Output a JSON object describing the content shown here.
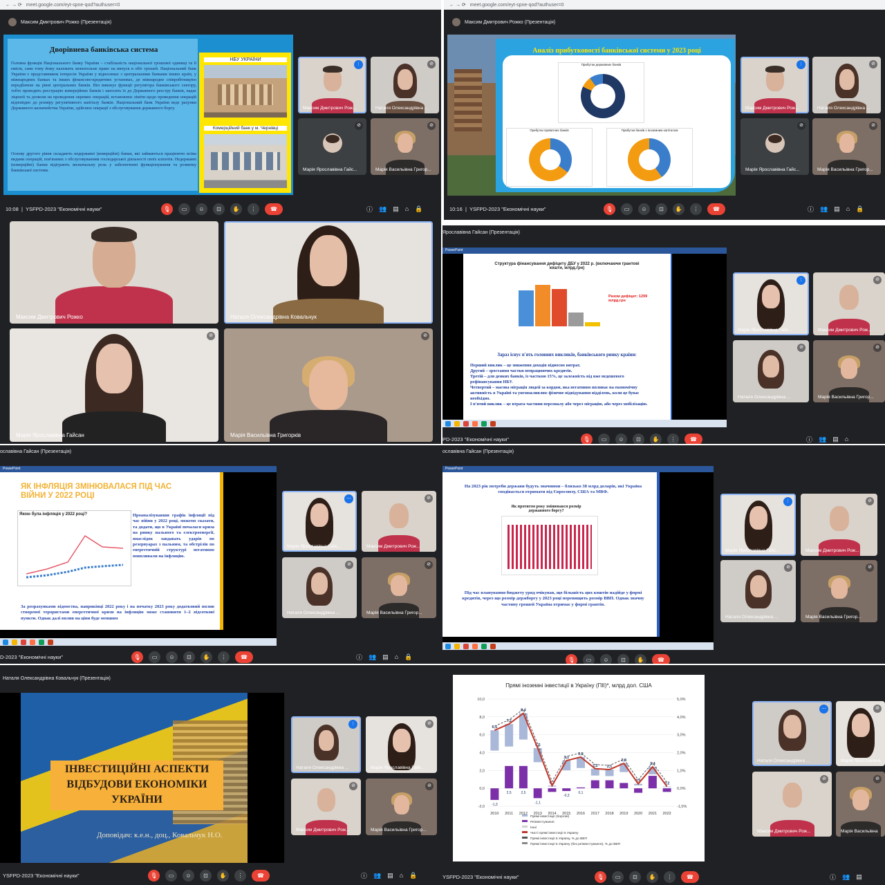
{
  "panel1": {
    "url": "meet.google.com/eyt-spne-qod?authuser=0",
    "presenter": "Максим Дмитрович Рожко (Презентація)",
    "slide_title": "Дворівнева банківська система",
    "slide_text_1": "Головна функція Національного банку України – стабільність національної грошової одиниці та її емісія, саме тому йому належить монопольне право на випуск в обіг грошей. Національний банк України є представником інтересів України у відносинах з центральними банками інших країн, у міжнародних банках та інших фінансово-кредитних установах, де міжнародне співробітництво передбачене на рівні центральних банків. Він виконує функції регулятора банківського сектору, тобто проводить реєстрацію комерційних банків і заносить їх до Державного реєстру банків, надає ліцензії та дозволи на проведення окремих операцій, встановлює ліміти щодо проведення операцій відповідно до розміру регулятивного капіталу банків. Національний банк України веде рахунки Державного казначейства України, здійснює операції з обслуговування державного боргу.",
    "slide_text_2": "Основу другого рівня складають недержавні (комерційні) банки, які займаються праціюючо всіма видами операцій, пов'язаних з обслуговуванням господарської діяльності своїх клієнтів. Недержавні (комерційні) банки відіграють визначальну роль у забезпеченні функціонування та розвитку банківської системи.",
    "nbu_label": "НБУ УКРАЇНИ",
    "bank_label": "Комерційний банк у м. Чернівці",
    "time": "10:08",
    "meeting": "YSFPD-2023 \"Економічні науки\"",
    "participants": [
      "Максим Дмитрович Рож...",
      "Наталя Олександрівна ...",
      "Марія Ярославівна Гайс...",
      "Марія Васильівна Григор..."
    ],
    "count": "6"
  },
  "panel2": {
    "url": "meet.google.com/eyt-spne-qod?authuser=0",
    "presenter": "Максим Дмитрович Рожко (Презентація)",
    "slide_title": "Аналіз прибутковості банківської системи у 2023 році",
    "chart1": "Прибутки державних банків",
    "chart2": "Прибутки приватних банків",
    "chart3": "Прибутки банків з іноземним капіталом",
    "time": "10:16",
    "meeting": "YSFPD-2023 \"Економічні науки\"",
    "participants": [
      "Максим Дмитрович Рож...",
      "Наталя Олександрівна ...",
      "Марія Ярославівна Гайс...",
      "Марія Васильівна Григор..."
    ],
    "count": "6"
  },
  "panel3": {
    "participants": [
      "Максим Дмитрович Рожко",
      "Наталя Олександрівна Ковальчук",
      "Марія Ярославівна Гайсан",
      "Марія Васильівна Григорків"
    ]
  },
  "panel4": {
    "presenter": "Ярославівна Гайсан (Презентація)",
    "chart_title": "Структура фінансування дефіциту ДБУ у 2022 р. (включаючи грантові кошти, млрд.грн)",
    "deficit": "Разом дефіцит: 1299 млрд.грн",
    "heading": "Зараз існує п'ять головних викликів, банківського ринку країни:",
    "items": [
      "Перший виклик – це зниження доходів відносно витрат.",
      "Другий – зростання частки непрацюючих кредитів.",
      "Третій – для деяких банків, із часткою 15%, це залежність від вже недешевого рефінансування НБУ.",
      "Четвертий – масова міграція людей за кордон, яка негативно впливає на економічну активність в Україні та унеможливлює фізичне відвідування відділень, коли це буває необхідно.",
      "І п'ятий виклик – це втрата частини персоналу або через міграцію, або через мобілізацію."
    ],
    "meeting": "PD-2023 \"Економічні науки\"",
    "participants": [
      "Марія Ярославівна Гайс...",
      "Максим Дмитрович Рож...",
      "Наталя Олександрівна ...",
      "Марія Васильівна Григор..."
    ]
  },
  "panel5": {
    "presenter": "ославівна Гайсан (Презентація)",
    "slide_title": "ЯК ІНФЛЯЦІЯ ЗМІНЮВАЛАСЯ ПІД ЧАС ВІЙНИ У 2022 РОЦІ",
    "chart_title": "Якою була інфляція у 2022 році?",
    "text_right": "Проаналізувавши графік інфляції під час війни у 2022 році, можемо сказати, та додати, що в Україні почалася криза на ринку пального та електроенергії, внаслідок завдавать ударів по резервуарах з пальним, та обстрілів по енергетичній структурі негативно повпливали на інфляцію.",
    "text_bottom": "За розрахунками відомства, наприкінці 2022 року і на початку 2023 року додатковий вплив створеної терористами енергетичної кризи на інфляцію може становити 1–2 відсоткові пункти. Однак далі вплив на ціни буде меншим",
    "meeting": "D-2023 \"Економічні науки\"",
    "participants": [
      "Марія Ярославівна Гайс...",
      "Максим Дмитрович Рож...",
      "Наталя Олександрівна ...",
      "Марія Васильівна Григор..."
    ]
  },
  "panel6": {
    "presenter": "ославівна Гайсан (Презентація)",
    "text_top": "На 2023 рік потреби держави будуть значними – близько 38 млрд доларів, які Україна сподівається отримати від Євросоюзу, США та МВФ.",
    "chart_title": "Як протягом року змінювався розмір державного боргу?",
    "text_bottom": "Під час планування бюджету уряд очікував, що більшість цих коштів надійде у формі кредитів, через що розмір держборгу у 2023 році перевищить розмір ВВП. Однак значну частину грошей Україна отримає у формі грантів.",
    "participants": [
      "Марія Ярославівна Гайс...",
      "Максим Дмитрович Рож...",
      "Наталя Олександрівна ...",
      "Марія Васильівна Григор..."
    ]
  },
  "panel7": {
    "presenter": "Наталя Олександрівна Ковальчук (Презентація)",
    "slide_title": "ІНВЕСТИЦІЙНІ АСПЕКТИ ВІДБУДОВИ ЕКОНОМІКИ УКРАЇНИ",
    "speaker": "Доповідач: к.е.н., доц., Ковальчук Н.О.",
    "meeting": "YSFPD-2023 \"Економічні науки\"",
    "participants": [
      "Наталя Олександрівна ...",
      "Марія Ярославівна Гайс...",
      "Максим Дмитрович Рож...",
      "Марія Васильівна Григор..."
    ]
  },
  "panel8": {
    "meeting": "YSFPD-2023 \"Економічні науки\"",
    "participants": [
      "Наталя Олександрівна ...",
      "Марія Ярославівна",
      "Максим Дмитрович Рож...",
      "Марія Васильівна"
    ]
  },
  "chart_data": {
    "type": "bar",
    "title": "Прямі іноземні інвестиції в Україну (ПІІ)*, млрд дол. США",
    "categories": [
      "2010",
      "2011",
      "2012",
      "2013",
      "2014",
      "2015",
      "2016",
      "2017",
      "2018",
      "2019",
      "2020",
      "2021",
      "2022"
    ],
    "series": [
      {
        "name": "Чисті прямі інвестиції",
        "values": [
          6.5,
          7.2,
          8.4,
          4.5,
          0.3,
          3.1,
          3.5,
          2.2,
          2.1,
          2.8,
          0.5,
          2.4,
          0.2
        ]
      },
      {
        "name": "Реінвестування",
        "values": [
          -1.3,
          2.5,
          2.5,
          -1.1,
          -0.4,
          -0.3,
          0.1,
          0.9,
          0.9,
          0.6,
          -0.5,
          1.4,
          -0.4
        ]
      }
    ],
    "labels_top": [
      "6,5",
      "7,2",
      "8,4",
      "4,5",
      "0,3",
      "3,1",
      "3,5",
      "2,2",
      "2,1",
      "2,8",
      "0,5",
      "2,4",
      "0,2"
    ],
    "labels_bottom": [
      "-1,3",
      "2,5",
      "2,5",
      "-1,1",
      "",
      "-0,3",
      "0,1",
      "",
      "",
      "",
      "",
      "",
      ""
    ],
    "yticks_left": [
      "10,0",
      "8,0",
      "6,0",
      "4,0",
      "2,0",
      "0,0",
      "-2,0"
    ],
    "yticks_right": [
      "5,0%",
      "4,0%",
      "3,0%",
      "2,0%",
      "1,0%",
      "0,0%",
      "-1,0%"
    ],
    "legend": [
      "Прямі інвестиції (боргові)",
      "Реінвестування",
      "Інші",
      "Чисті прямі інвестиції в Україну",
      "Прямі інвестиції в Україну, % до ВВП",
      "Прямі інвестиції в Україну (без реінвестування), % до ВВП"
    ],
    "ylim": [
      -2,
      10
    ]
  },
  "colors": {
    "meet_bg": "#202124",
    "tile_bg": "#3c4043",
    "red": "#ea4335",
    "blue": "#1a73e8",
    "slide_blue": "#1e88c8",
    "yellow": "#ffe600"
  }
}
